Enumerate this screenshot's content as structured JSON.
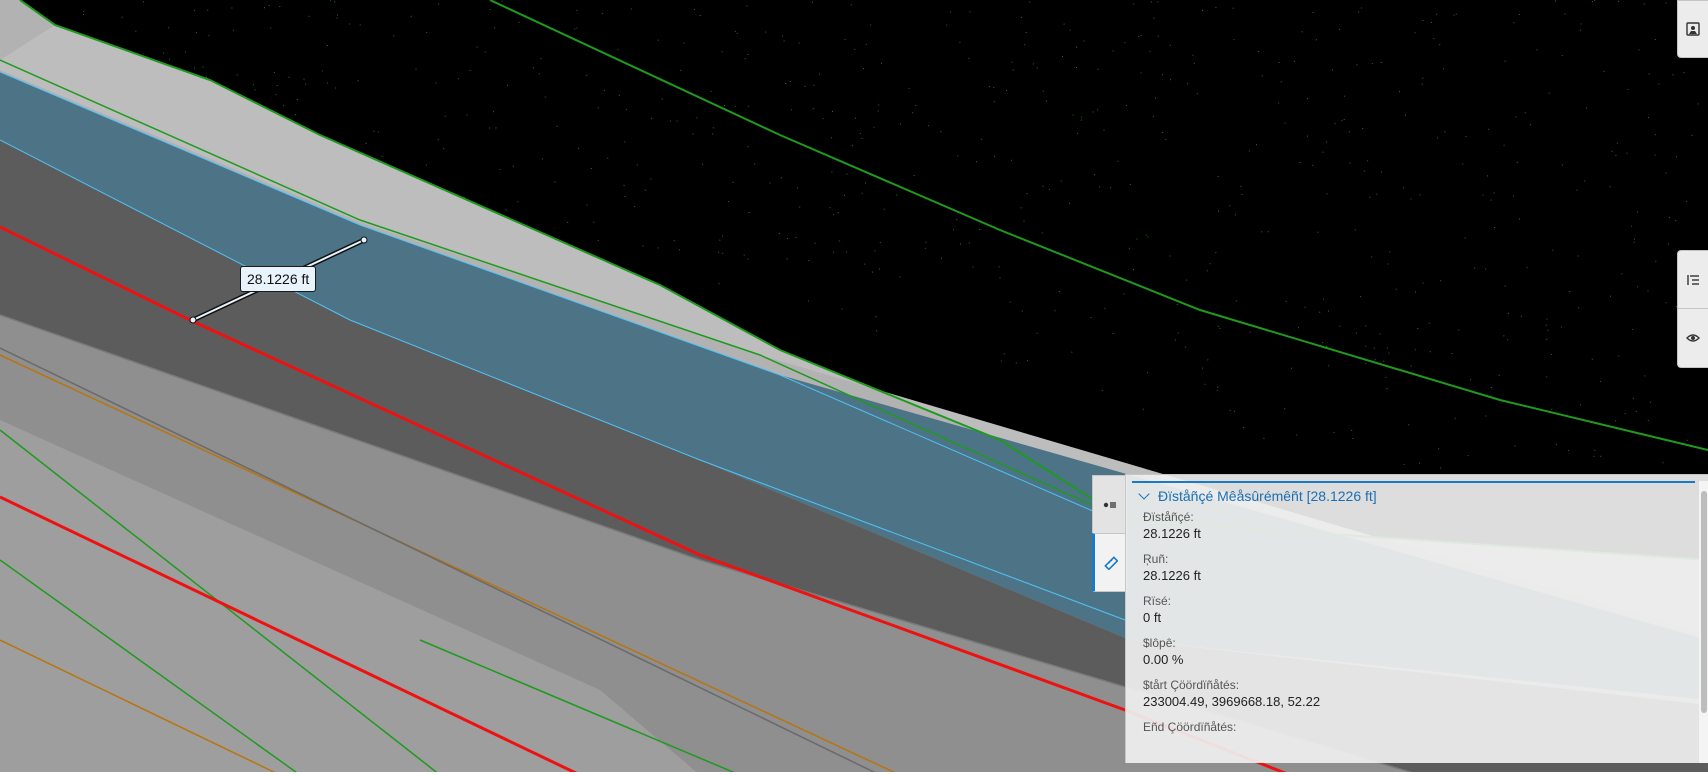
{
  "viewer": {
    "measurement_label": "28.1226 ft"
  },
  "toolbar": {
    "top_button_icon": "image-capture-icon",
    "tree_button_icon": "tree-list-icon",
    "visibility_button_icon": "eye-icon"
  },
  "panel": {
    "tabs": [
      {
        "icon": "properties-icon"
      },
      {
        "icon": "ruler-icon"
      }
    ],
    "header": "Ðïståñçé Mêåsûrémêñt [28.1226 ft]",
    "fields": [
      {
        "label": "Ðïståñçé:",
        "value": "28.1226 ft"
      },
      {
        "label": "Ŗuñ:",
        "value": "28.1226 ft"
      },
      {
        "label": "Rïsé:",
        "value": "0 ft"
      },
      {
        "label": "$lôpê:",
        "value": "0.00 %"
      },
      {
        "label": "$tårt Çöördïñåtés:",
        "value": "233004.49, 3969668.18, 52.22"
      },
      {
        "label": "Eñd Çöördïñåtés:",
        "value": ""
      }
    ]
  },
  "colors": {
    "sky": "#000000",
    "road_gray": "#5a5a5a",
    "shoulder_gray": "#b4b4b4",
    "water_blue": "#4a7185",
    "green_line": "#1f9a1f",
    "red_line": "#ee1111",
    "orange_line": "#b8740f",
    "accent_blue": "#1a7bc4"
  }
}
